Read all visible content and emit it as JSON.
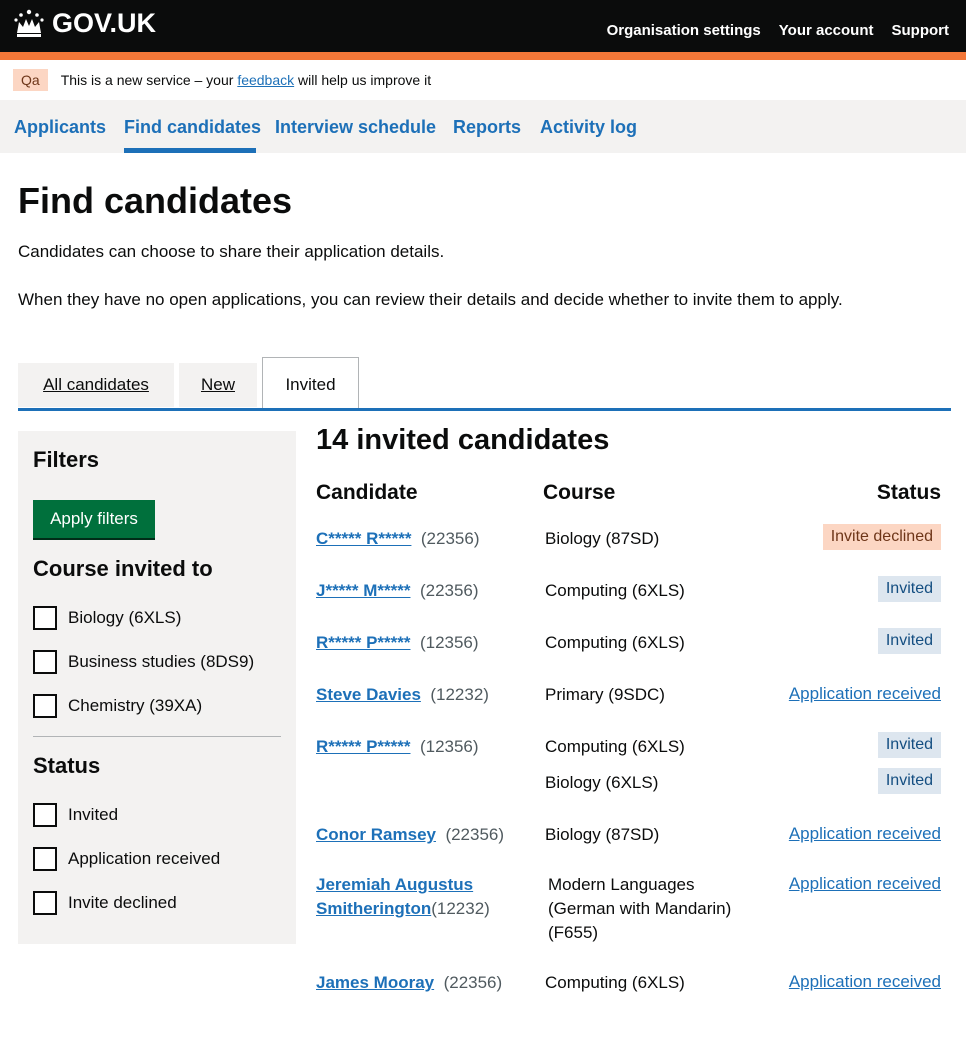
{
  "header": {
    "logo_text": "GOV.UK",
    "nav": [
      "Organisation settings",
      "Your account",
      "Support"
    ]
  },
  "phase": {
    "tag": "Qa",
    "text_before": "This is a new service – your ",
    "link": "feedback",
    "text_after": " will help us improve it"
  },
  "primary_nav": {
    "items": [
      "Applicants",
      "Find candidates",
      "Interview schedule",
      "Reports",
      "Activity log"
    ],
    "active": "Find candidates"
  },
  "page": {
    "title": "Find candidates",
    "lead1": "Candidates can choose to share their application details.",
    "lead2": "When they have no open applications, you can review their details and decide whether to invite them to apply."
  },
  "tabs": [
    "All candidates",
    "New",
    "Invited"
  ],
  "filters": {
    "heading": "Filters",
    "apply": "Apply filters",
    "course_heading": "Course invited to",
    "courses": [
      "Biology (6XLS)",
      "Business studies (8DS9)",
      "Chemistry (39XA)"
    ],
    "status_heading": "Status",
    "statuses": [
      "Invited",
      "Application received",
      "Invite declined"
    ]
  },
  "results": {
    "heading": "14 invited candidates",
    "col_candidate": "Candidate",
    "col_course": "Course",
    "col_status": "Status",
    "rows": [
      {
        "name": "C***** R*****",
        "id": "(22356)",
        "course": "Biology (87SD)",
        "status": "Invite declined"
      },
      {
        "name": "J***** M*****",
        "id": "(22356)",
        "course": "Computing (6XLS)",
        "status": "Invited"
      },
      {
        "name": "R***** P*****",
        "id": "(12356)",
        "course": "Computing (6XLS)",
        "status": "Invited"
      },
      {
        "name": "Steve Davies",
        "id": "(12232)",
        "course": "Primary (9SDC)",
        "status": "Application received"
      },
      {
        "name": "R***** P*****",
        "id": "(12356)",
        "course": "Computing (6XLS)",
        "status": "Invited",
        "course2": "Biology (6XLS)",
        "status2": "Invited"
      },
      {
        "name": "Conor Ramsey",
        "id": "(22356)",
        "course": "Biology (87SD)",
        "status": "Application received"
      },
      {
        "name": "Jeremiah Augustus Smitherington",
        "id": "(12232)",
        "course": "Modern Languages (German with Mandarin) (F655)",
        "status": "Application received"
      },
      {
        "name": "James Mooray",
        "id": "(22356)",
        "course": "Computing (6XLS)",
        "status": "Application received"
      }
    ]
  }
}
